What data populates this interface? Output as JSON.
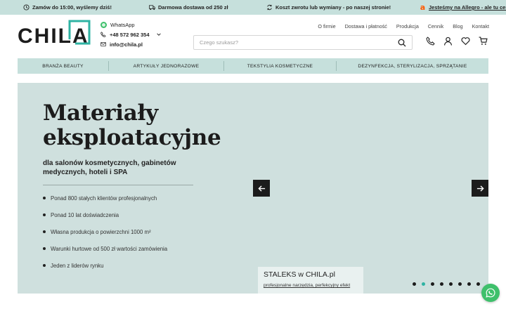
{
  "colors": {
    "accent_bar": "#c6e0dc",
    "hero_bg": "#cfe0de",
    "logo_teal": "#2fb3a3",
    "whatsapp": "#3ec06b",
    "allegro": "#ff5a00"
  },
  "topbar": {
    "items": [
      {
        "icon": "clock-icon",
        "text": "Zamów do 15:00, wyślemy dziś!"
      },
      {
        "icon": "truck-icon",
        "text": "Darmowa dostawa od 250 zł"
      },
      {
        "icon": "return-icon",
        "text": "Koszt zwrotu lub wymiany - po naszej stronie!"
      },
      {
        "icon": "allegro-icon",
        "text": "Jesteśmy na Allegro - ale tu ceny lo"
      }
    ]
  },
  "logo": {
    "text": "CHILA"
  },
  "contacts": {
    "whatsapp": "WhatsApp",
    "phone": "+48 572 962 354",
    "email": "info@chila.pl"
  },
  "nav": [
    "O firmie",
    "Dostawa i płatność",
    "Produkcja",
    "Cennik",
    "Blog",
    "Kontakt"
  ],
  "search": {
    "placeholder": "Czego szukasz?"
  },
  "header_icons": [
    "phone-icon",
    "user-icon",
    "heart-icon",
    "cart-icon"
  ],
  "categories": [
    "BRANŻA BEAUTY",
    "ARTYKUŁY JEDNORAZOWE",
    "TEKSTYLIA KOSMETYCZNE",
    "DEZYNFEKCJA, STERYLIZACJA, SPRZĄTANIE"
  ],
  "hero": {
    "title_line1": "Materiały",
    "title_line2": "eksploatacyjne",
    "subtitle": "dla salonów kosmetycznych, gabinetów medycznych, hoteli i SPA",
    "bullets": [
      "Ponad 800 stałych klientów profesjonalnych",
      "Ponad 10 lat doświadczenia",
      "Własna produkcja o powierzchni 1000 m²",
      "Warunki hurtowe od 500 zł wartości zamówienia",
      "Jeden z liderów rynku"
    ],
    "card_title": "STALEKS w CHILA.pl",
    "card_sub": "profesjonalne narzędzia, perfekcyjny efekt",
    "slides_total": 8,
    "active_slide": 2
  }
}
